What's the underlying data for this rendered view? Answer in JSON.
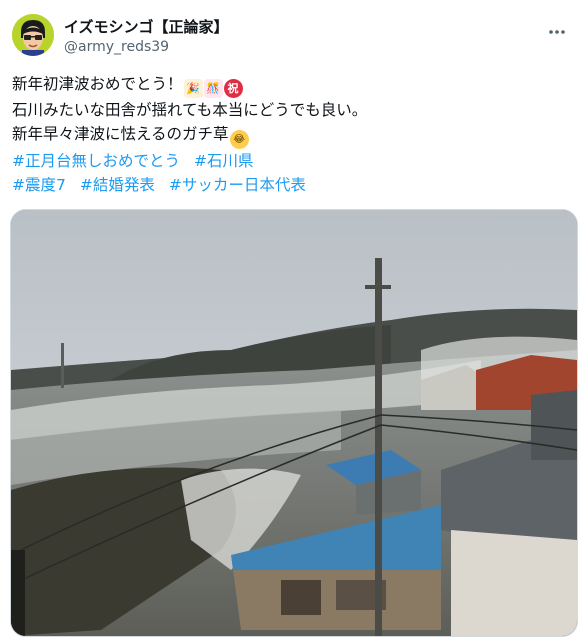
{
  "author": {
    "display_name": "イズモシンゴ【正論家】",
    "handle": "@army_reds39"
  },
  "header": {
    "more_icon": "more-horizontal-icon"
  },
  "tweet": {
    "lines": [
      "新年初津波おめでとう！",
      "石川みたいな田舎が揺れても本当にどうでも良い。",
      "新年早々津波に怯えるのガチ草"
    ],
    "emojis": {
      "party_popper": "🎉",
      "confetti_ball": "🎊",
      "iwai": "祝",
      "laughing": "😂"
    },
    "hashtags_row1": [
      "#正月台無しおめでとう",
      "#石川県"
    ],
    "hashtags_row2": [
      "#震度7",
      "#結婚発表",
      "#サッカー日本代表"
    ]
  },
  "colors": {
    "link": "#1d9bf0",
    "handle": "#536471",
    "text": "#0f1419",
    "border": "#cfd9de",
    "avatar_bg": "#b8d42c"
  }
}
